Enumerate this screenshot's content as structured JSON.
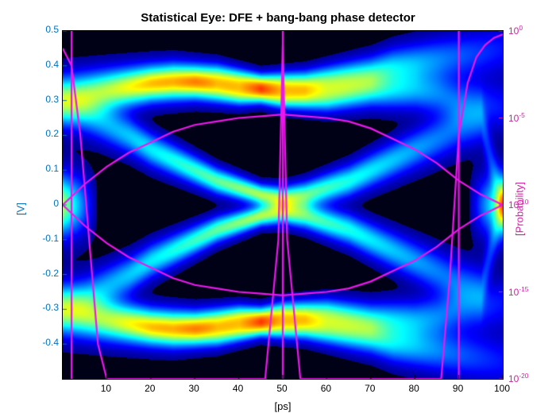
{
  "title": "Statistical Eye: DFE + bang-bang phase detector",
  "xlabel": "[ps]",
  "ylabel_left": "[V]",
  "ylabel_right": "[Probability]",
  "colors": {
    "left_axis": "#0072BD",
    "right_axis": "#D41FA3",
    "bathtub": "#ED17ED"
  },
  "chart_data": {
    "type": "heatmap",
    "xlim": [
      0,
      100
    ],
    "ylim_left": [
      -0.5,
      0.5
    ],
    "ylim_right_log10": [
      -20,
      0
    ],
    "xticks": [
      10,
      20,
      30,
      40,
      50,
      60,
      70,
      80,
      90,
      100
    ],
    "yticks_left": [
      -0.4,
      -0.3,
      -0.2,
      -0.1,
      0,
      0.1,
      0.2,
      0.3,
      0.4,
      0.5
    ],
    "yticks_right_exp": [
      0,
      -5,
      -10,
      -15,
      -20
    ],
    "eye_trace_centers": {
      "comment": "approx voltage of rail centers vs time (ps); eye is symmetric about 0V",
      "x": [
        0,
        5,
        10,
        15,
        20,
        25,
        30,
        35,
        40,
        45,
        50,
        55,
        60,
        65,
        70,
        75,
        80,
        85,
        90,
        95,
        100
      ],
      "upper": [
        0.3,
        0.31,
        0.32,
        0.33,
        0.34,
        0.34,
        0.34,
        0.33,
        0.32,
        0.32,
        0.31,
        0.31,
        0.31,
        0.32,
        0.33,
        0.33,
        0.33,
        0.32,
        0.3,
        0.29,
        0.28
      ],
      "branch_up_hi": [
        0.32,
        0.33,
        0.34,
        0.35,
        0.36,
        0.37,
        0.37,
        0.37,
        0.36,
        0.35,
        0.35,
        0.35,
        0.36,
        0.37,
        0.38,
        0.4,
        0.41,
        0.42,
        0.43,
        0.44,
        0.45
      ],
      "branch_up_lo": [
        0.28,
        0.26,
        0.23,
        0.2,
        0.16,
        0.13,
        0.1,
        0.07,
        0.05,
        0.03,
        0.02,
        0.03,
        0.05,
        0.07,
        0.1,
        0.13,
        0.16,
        0.19,
        0.22,
        0.24,
        0.0
      ]
    },
    "bathtub_vertical": {
      "comment": "overlay curve, voltage vs time at sample phase (magenta eye contour)",
      "x": [
        0,
        5,
        10,
        15,
        20,
        25,
        30,
        35,
        40,
        45,
        50,
        55,
        60,
        65,
        70,
        75,
        80,
        85,
        90,
        95,
        100
      ],
      "y_upper": [
        0.0,
        0.06,
        0.11,
        0.15,
        0.18,
        0.21,
        0.23,
        0.24,
        0.25,
        0.255,
        0.26,
        0.255,
        0.25,
        0.24,
        0.22,
        0.19,
        0.16,
        0.12,
        0.07,
        0.03,
        0.0
      ]
    },
    "bathtub_horizontal": {
      "comment": "probability vs time (right axis), log10 values",
      "x": [
        0,
        2,
        4,
        6,
        8,
        10,
        20,
        30,
        40,
        46,
        49,
        50,
        51,
        54,
        60,
        70,
        80,
        86,
        88,
        90,
        92,
        94,
        96,
        98,
        100
      ],
      "log10p": [
        -1.0,
        -2.0,
        -6.0,
        -12.0,
        -18.0,
        -20.0,
        -20.0,
        -20.0,
        -20.0,
        -20.0,
        -12.0,
        -0.8,
        -12.0,
        -20.0,
        -20.0,
        -20.0,
        -20.0,
        -20.0,
        -14.0,
        -6.0,
        -3.0,
        -1.5,
        -0.8,
        -0.4,
        -0.2
      ]
    }
  }
}
